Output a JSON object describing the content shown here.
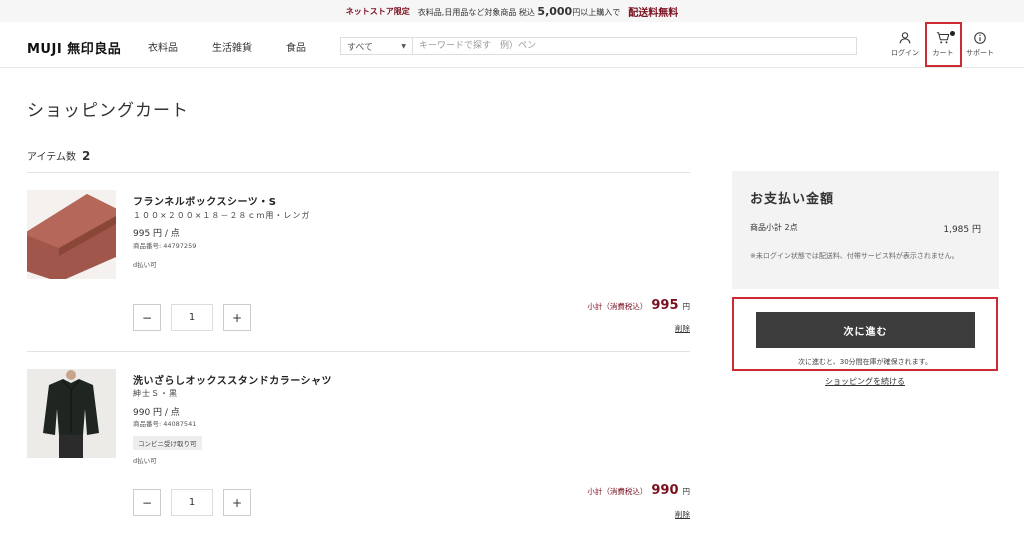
{
  "banner": {
    "tag": "ネットストア限定",
    "text": "衣料品,日用品など対象商品 税込",
    "amount": "5,000",
    "suffix": "円以上購入で",
    "free": "配送料無料"
  },
  "header": {
    "logo": "MUJI 無印良品",
    "nav": [
      "衣料品",
      "生活雑貨",
      "食品"
    ],
    "search_category": "すべて",
    "search_placeholder": "キーワードで探す　例）ペン",
    "login_label": "ログイン",
    "cart_label": "カート",
    "support_label": "サポート"
  },
  "page": {
    "title": "ショッピングカート",
    "item_count_label": "アイテム数",
    "item_count": "2"
  },
  "items": [
    {
      "name": "フランネルボックスシーツ・S",
      "spec": "１００×２００×１８－２８ｃｍ用・レンガ",
      "price": "995 円 / 点",
      "code": "商品番号: 44797259",
      "badge": "",
      "note": "d払い可",
      "quantity": "1",
      "subtotal_label": "小計（消費税込）",
      "subtotal": "995",
      "yen": "円",
      "delete": "削除"
    },
    {
      "name": "洗いざらしオックススタンドカラーシャツ",
      "spec": "紳士Ｓ・黒",
      "price": "990 円 / 点",
      "code": "商品番号: 44087541",
      "badge": "コンビニ受け取り可",
      "note": "d払い可",
      "quantity": "1",
      "subtotal_label": "小計（消費税込）",
      "subtotal": "990",
      "yen": "円",
      "delete": "削除"
    }
  ],
  "summary": {
    "title": "お支払い金額",
    "subtotal_label": "商品小計 2点",
    "subtotal_value": "1,985 円",
    "note": "※未ログイン状態では配送料、付帯サービス料が表示されません。",
    "next_label": "次に進む",
    "hold_note": "次に進むと、30分間在庫が確保されます。",
    "continue_label": "ショッピングを続ける"
  },
  "colors": {
    "accent": "#7a0f1e",
    "highlight": "#cc2b33",
    "button": "#3c3c3c"
  }
}
